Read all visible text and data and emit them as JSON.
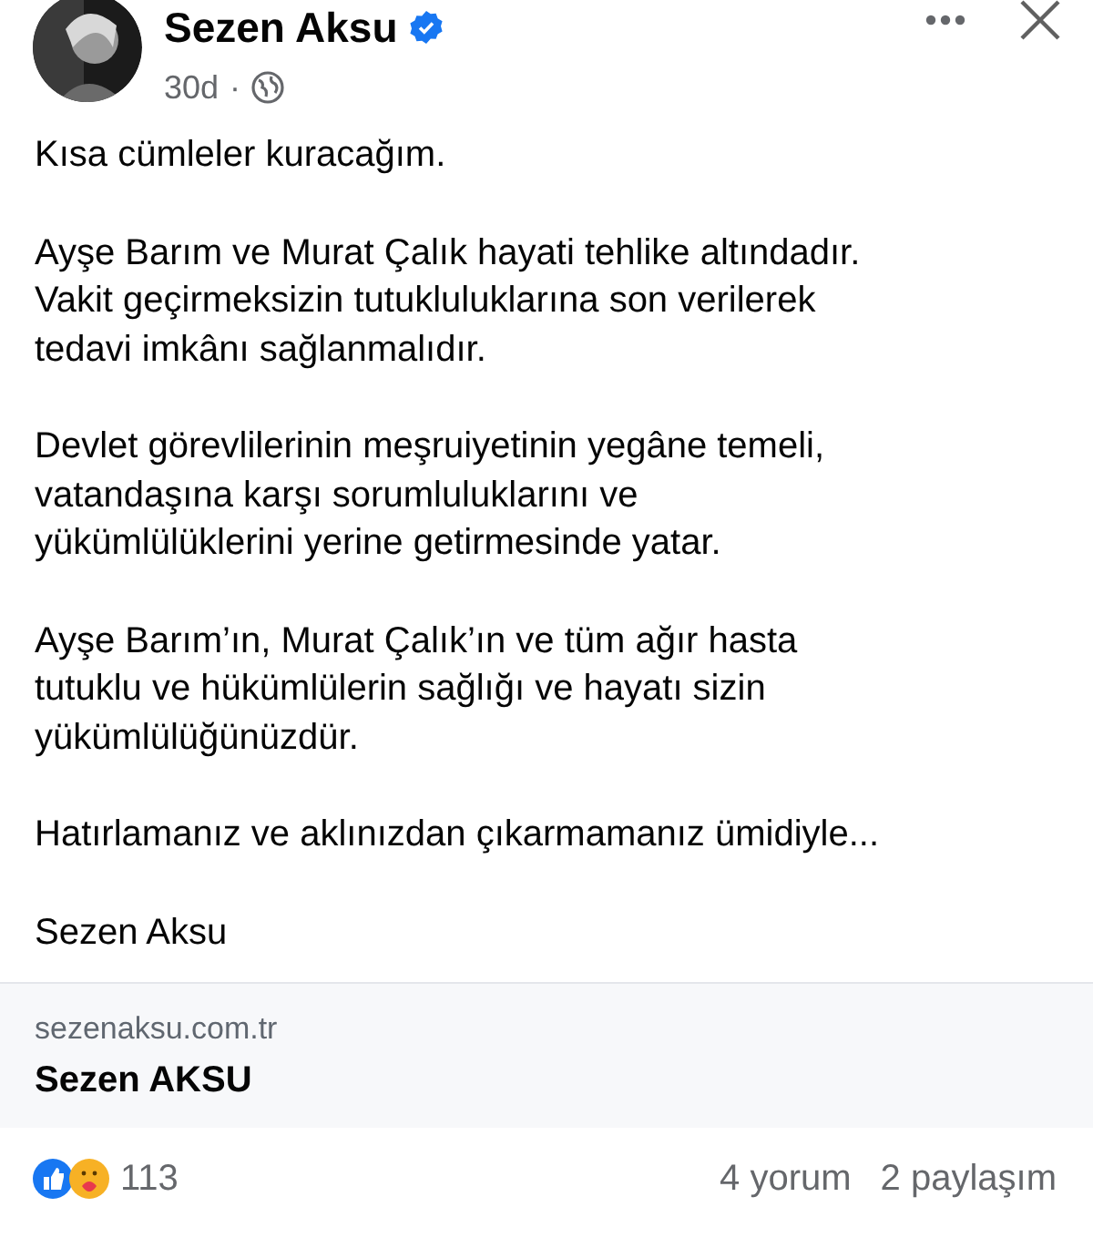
{
  "post": {
    "author": "Sezen Aksu",
    "verified": true,
    "time": "30d",
    "separator": "·",
    "paragraphs": [
      "Kısa cümleler kuracağım.",
      "Ayşe Barım ve Murat Çalık hayati tehlike altındadır.\nVakit geçirmeksizin tutukluluklarına son verilerek\ntedavi imkânı sağlanmalıdır.",
      "Devlet görevlilerinin meşruiyetinin yegâne temeli,\nvatandaşına karşı sorumluluklarını ve\nyükümlülüklerini yerine getirmesinde yatar.",
      "Ayşe Barım’ın, Murat Çalık’ın ve tüm ağır hasta\ntutuklu ve hükümlülerin sağlığı ve hayatı sizin\nyükümlülüğünüzdür.",
      "Hatırlamanız ve aklınızdan çıkarmamanız ümidiyle...",
      "Sezen Aksu"
    ],
    "link": {
      "domain": "sezenaksu.com.tr",
      "title": "Sezen AKSU"
    },
    "reactions": {
      "count": "113",
      "comments": "4 yorum",
      "shares": "2 paylaşım"
    }
  }
}
